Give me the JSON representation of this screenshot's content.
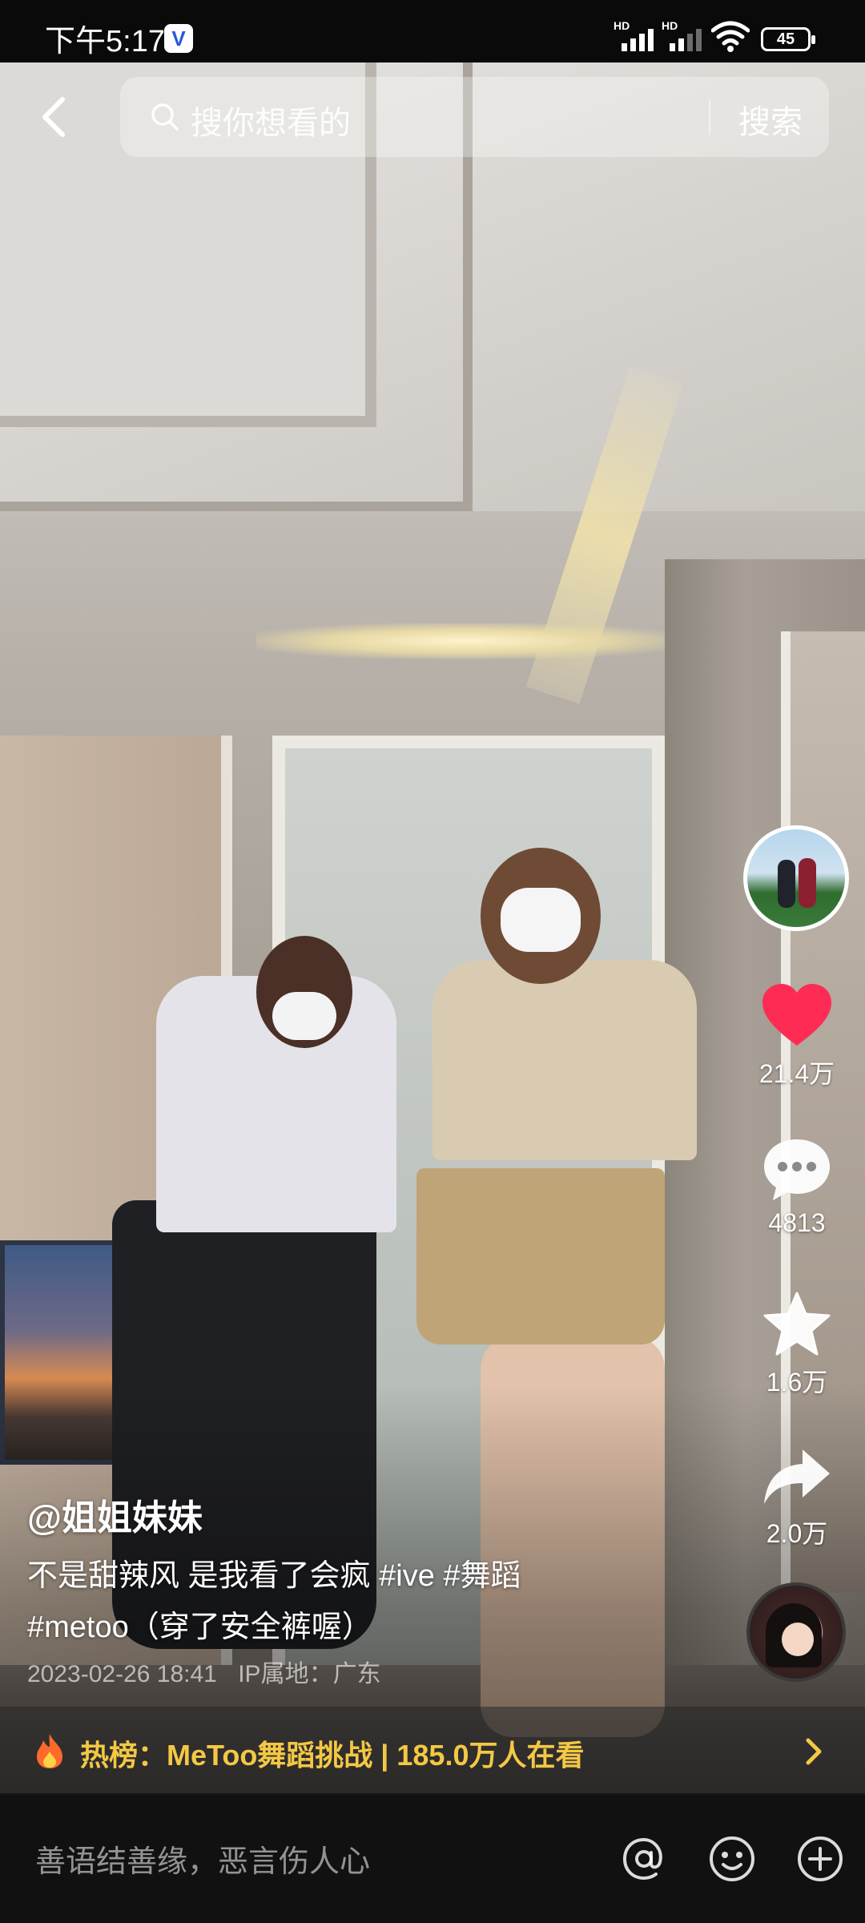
{
  "status_bar": {
    "time": "下午5:17",
    "vpn_badge": "V",
    "signal_1_label": "HD",
    "signal_2_label": "HD",
    "battery": "45"
  },
  "search": {
    "placeholder": "搜你想看的",
    "button_label": "搜索"
  },
  "actions": {
    "likes": "21.4万",
    "comments": "4813",
    "favorites": "1.6万",
    "shares": "2.0万"
  },
  "caption": {
    "author": "@姐姐妹妹",
    "line1": "不是甜辣风 是我看了会疯 #ive #舞蹈",
    "line2": "#metoo（穿了安全裤喔）",
    "date": "2023-02-26 18:41",
    "location": "IP属地：广东"
  },
  "hot_list": {
    "text": "热榜：MeToo舞蹈挑战 | 185.0万人在看"
  },
  "comment_bar": {
    "placeholder": "善语结善缘，恶言伤人心"
  },
  "colors": {
    "like_red": "#fe2c55",
    "hot_yellow": "#f3c845",
    "fire_orange": "#ff6a2b"
  }
}
